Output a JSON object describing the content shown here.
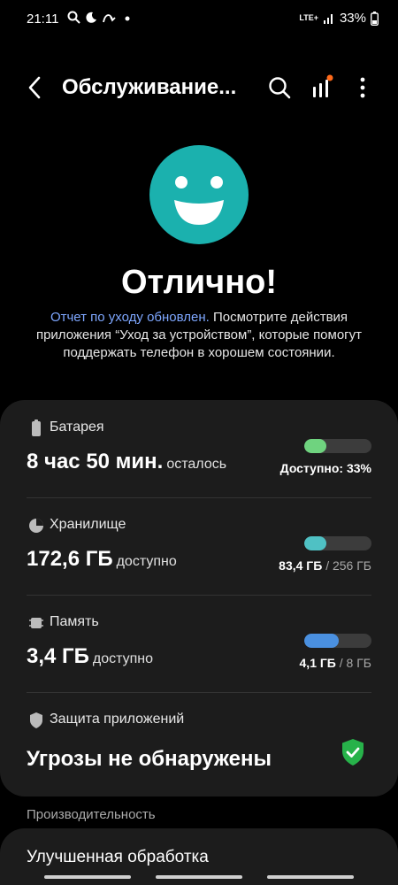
{
  "status_bar": {
    "time": "21:11",
    "network": "LTE+",
    "battery": "33%"
  },
  "app_bar": {
    "title": "Обслуживание..."
  },
  "status": {
    "heading": "Отлично!",
    "link_text": "Отчет по уходу обновлен.",
    "description": " Посмотрите действия приложения “Уход за устройством”, которые помогут поддержать телефон в хорошем состоянии."
  },
  "card": {
    "battery": {
      "title": "Батарея",
      "value": "8 час 50 мин.",
      "suffix": "осталось",
      "meta": "Доступно: 33%",
      "level": 0.33,
      "color": "#6fd37f"
    },
    "storage": {
      "title": "Хранилище",
      "value": "172,6 ГБ",
      "suffix": "доступно",
      "used": "83,4 ГБ",
      "total": "/ 256 ГБ",
      "level": 0.33,
      "color": "#4fc1c4"
    },
    "memory": {
      "title": "Память",
      "value": "3,4 ГБ",
      "suffix": "доступно",
      "used": "4,1 ГБ",
      "total": "/ 8 ГБ",
      "level": 0.51,
      "color": "#4a90e0"
    },
    "protection": {
      "title": "Защита приложений",
      "value": "Угрозы не обнаружены",
      "status_color": "#27b24a"
    }
  },
  "performance": {
    "section_label": "Производительность",
    "item_title": "Улучшенная обработка"
  },
  "colors": {
    "accent": "#1bb1ae",
    "link": "#7ea7ff",
    "card_bg": "#1c1c1c"
  }
}
